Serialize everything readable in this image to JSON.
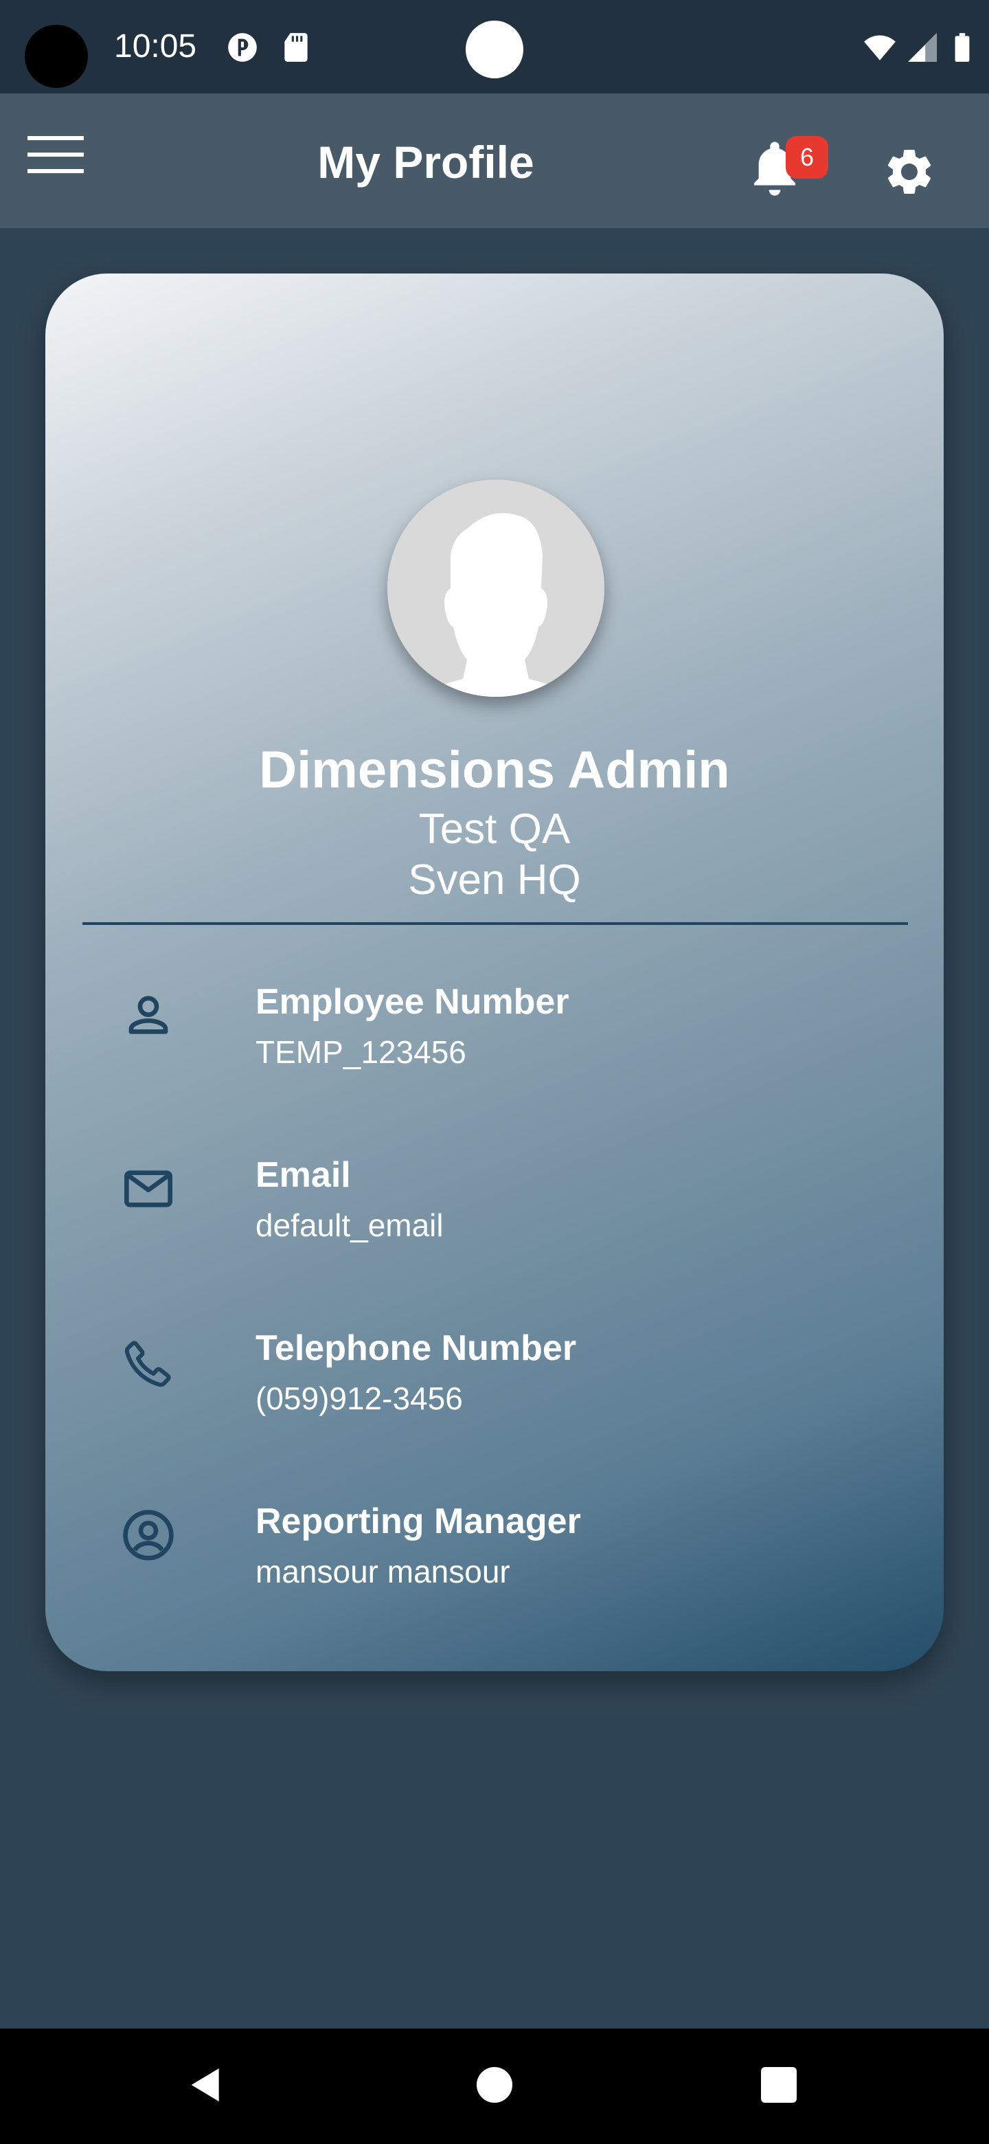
{
  "status_bar": {
    "time": "10:05",
    "icons": [
      "notification-app-icon",
      "sd-card-icon",
      "wifi-icon",
      "signal-icon",
      "battery-icon"
    ]
  },
  "app_bar": {
    "title": "My Profile",
    "notification_count": "6",
    "icons": [
      "menu-icon",
      "bell-icon",
      "gear-icon"
    ]
  },
  "profile": {
    "name": "Dimensions Admin",
    "position": "Test QA",
    "location": "Sven HQ"
  },
  "info": [
    {
      "icon": "person-icon",
      "label": "Employee Number",
      "value": "TEMP_123456"
    },
    {
      "icon": "mail-icon",
      "label": "Email",
      "value": "default_email"
    },
    {
      "icon": "phone-icon",
      "label": "Telephone Number",
      "value": "(059)912-3456"
    },
    {
      "icon": "account-circle-icon",
      "label": "Reporting Manager",
      "value": "mansour mansour"
    }
  ],
  "colors": {
    "background": "#2f4454",
    "status_bar": "#22313f",
    "app_bar": "#485a68",
    "badge": "#e8392f",
    "accent_dark": "#1f4560"
  }
}
